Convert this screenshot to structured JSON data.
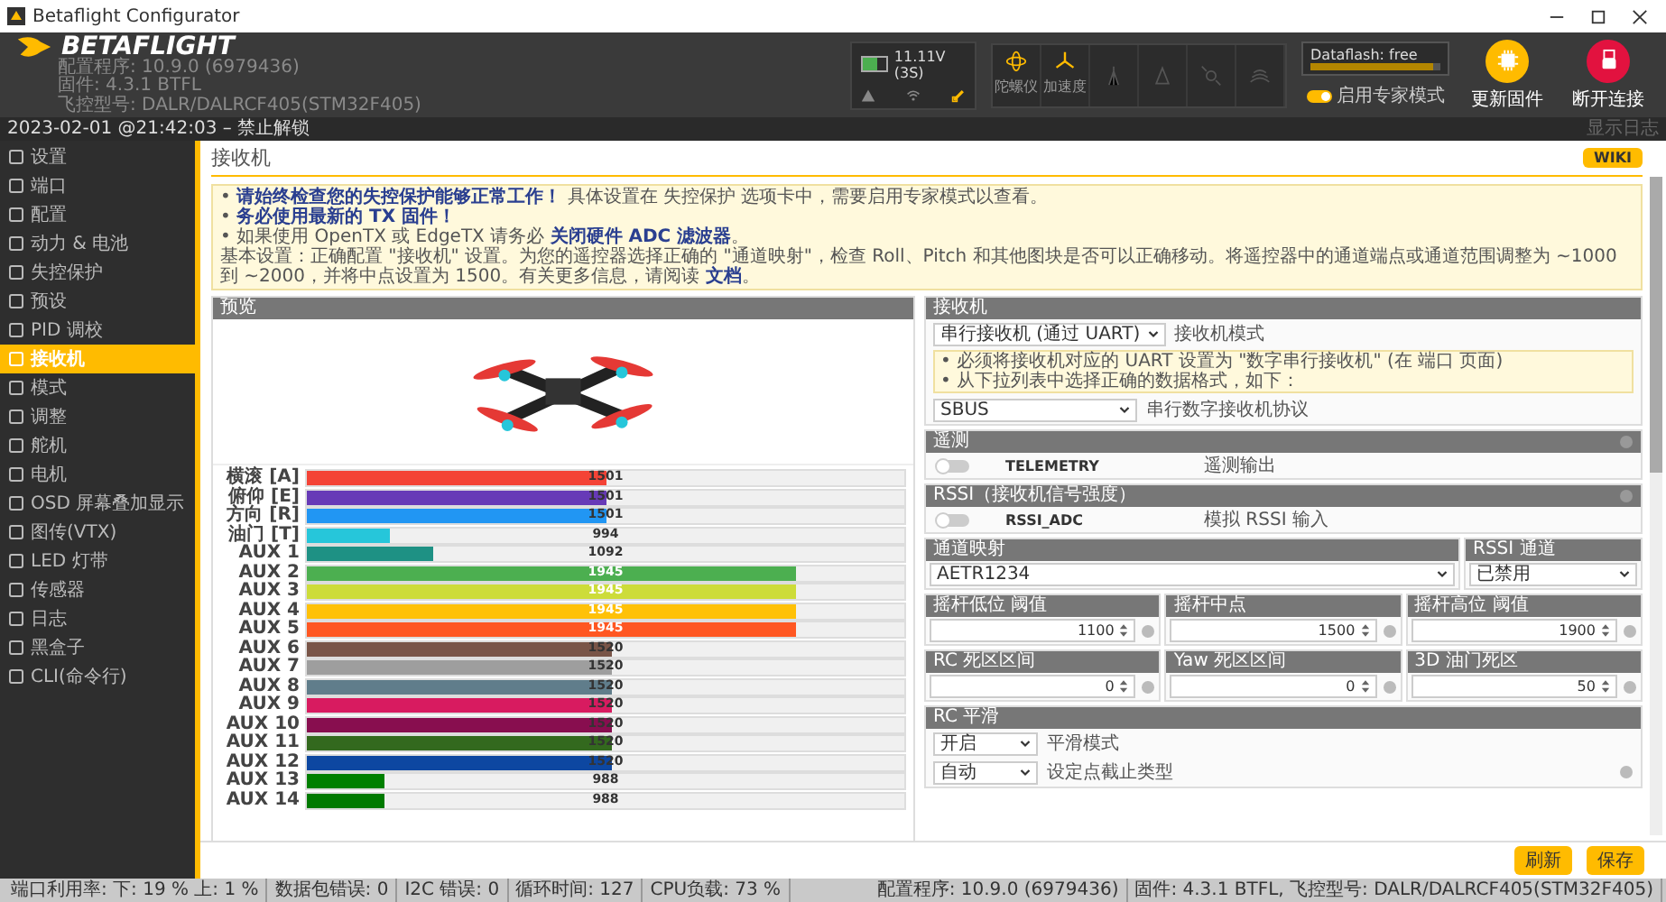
{
  "window": {
    "title": "Betaflight Configurator"
  },
  "header": {
    "logo": "BETAFLIGHT",
    "versions": [
      "配置程序: 10.9.0 (6979436)",
      "固件: 4.3.1 BTFL",
      "飞控型号: DALR/DALRCF405(STM32F405)"
    ],
    "battery": {
      "reading": "11.11V (3S)",
      "level": 0.6
    },
    "sensors": [
      {
        "kind": "gyro",
        "label": "陀螺仪",
        "on": true
      },
      {
        "kind": "acc",
        "label": "加速度",
        "on": true
      },
      {
        "kind": "baro",
        "on": false
      },
      {
        "kind": "mag",
        "on": false
      },
      {
        "kind": "gps",
        "on": false
      },
      {
        "kind": "sonar",
        "on": false
      }
    ],
    "dataflash": {
      "label": "Dataflash: free",
      "level": 0.95
    },
    "expert_mode": {
      "label": "启用专家模式",
      "on": true
    },
    "buttons": [
      {
        "kind": "update",
        "label": "更新固件"
      },
      {
        "kind": "disconnect",
        "label": "断开连接"
      }
    ]
  },
  "info_bar": {
    "datetime": "2023-02-01 @21:42:03 – 禁止解锁",
    "log_link": "显示日志"
  },
  "sidebar": {
    "items": [
      {
        "label": "设置",
        "selected": false
      },
      {
        "label": "端口",
        "selected": false
      },
      {
        "label": "配置",
        "selected": false
      },
      {
        "label": "动力 & 电池",
        "selected": false
      },
      {
        "label": "失控保护",
        "selected": false
      },
      {
        "label": "预设",
        "selected": false
      },
      {
        "label": "PID 调校",
        "selected": false
      },
      {
        "label": "接收机",
        "selected": true
      },
      {
        "label": "模式",
        "selected": false
      },
      {
        "label": "调整",
        "selected": false
      },
      {
        "label": "舵机",
        "selected": false
      },
      {
        "label": "电机",
        "selected": false
      },
      {
        "label": "OSD 屏幕叠加显示",
        "selected": false
      },
      {
        "label": "图传(VTX)",
        "selected": false
      },
      {
        "label": "LED 灯带",
        "selected": false
      },
      {
        "label": "传感器",
        "selected": false
      },
      {
        "label": "日志",
        "selected": false
      },
      {
        "label": "黑盒子",
        "selected": false
      },
      {
        "label": "CLI(命令行)",
        "selected": false
      }
    ]
  },
  "page": {
    "title": "接收机",
    "wiki": "WIKI",
    "notes": [
      "• **请始终检查您的失控保护能够正常工作！** 具体设置在 失控保护 选项卡中，需要启用专家模式以查看。",
      "• **务必使用最新的 TX 固件！**",
      "• 如果使用 OpenTX 或 EdgeTX 请务必 **关闭硬件 ADC 滤波器**。",
      "基本设置：正确配置 \"接收机\" 设置。为您的遥控器选择正确的 \"通道映射\"，检查 Roll、Pitch 和其他图块是否可以正确移动。将遥控器中的通道端点或通道范围调整为 ~1000 到 ~2000，并将中点设置为 1500。有关更多信息，请阅读 **文档**。"
    ],
    "preview": {
      "title": "预览"
    },
    "channels": [
      {
        "name": "横滚 [A]",
        "level": 0.5,
        "reading": "1501",
        "color": "#f44336"
      },
      {
        "name": "俯仰 [E]",
        "level": 0.5,
        "reading": "1501",
        "color": "#673ab7"
      },
      {
        "name": "方向 [R]",
        "level": 0.5,
        "reading": "1501",
        "color": "#2196f3"
      },
      {
        "name": "油门 [T]",
        "level": 0.14,
        "reading": "994",
        "color": "#26c6da"
      },
      {
        "name": "AUX 1",
        "level": 0.21,
        "reading": "1092",
        "color": "#1e9184"
      },
      {
        "name": "AUX 2",
        "level": 0.82,
        "reading": "1945",
        "color": "#4caf50"
      },
      {
        "name": "AUX 3",
        "level": 0.82,
        "reading": "1945",
        "color": "#cddc39"
      },
      {
        "name": "AUX 4",
        "level": 0.82,
        "reading": "1945",
        "color": "#ffc107"
      },
      {
        "name": "AUX 5",
        "level": 0.82,
        "reading": "1945",
        "color": "#ff5722"
      },
      {
        "name": "AUX 6",
        "level": 0.51,
        "reading": "1520",
        "color": "#795548"
      },
      {
        "name": "AUX 7",
        "level": 0.51,
        "reading": "1520",
        "color": "#9e9e9e"
      },
      {
        "name": "AUX 8",
        "level": 0.51,
        "reading": "1520",
        "color": "#607d8b"
      },
      {
        "name": "AUX 9",
        "level": 0.51,
        "reading": "1520",
        "color": "#d81b60"
      },
      {
        "name": "AUX 10",
        "level": 0.51,
        "reading": "1520",
        "color": "#880e4f"
      },
      {
        "name": "AUX 11",
        "level": 0.51,
        "reading": "1520",
        "color": "#33691e"
      },
      {
        "name": "AUX 12",
        "level": 0.51,
        "reading": "1520",
        "color": "#0d47a1"
      },
      {
        "name": "AUX 13",
        "level": 0.13,
        "reading": "988",
        "color": "#008000"
      },
      {
        "name": "AUX 14",
        "level": 0.13,
        "reading": "988",
        "color": "#007a00"
      }
    ],
    "receiver": {
      "title": "接收机",
      "mode": {
        "value": "串行接收机 (通过 UART)",
        "label": "接收机模式"
      },
      "notes": [
        "• 必须将接收机对应的 UART 设置为 \"数字串行接收机\" (在 端口 页面)",
        "• 从下拉列表中选择正确的数据格式，如下："
      ],
      "protocol": {
        "value": "SBUS",
        "label": "串行数字接收机协议"
      }
    },
    "features": [
      {
        "title": "遥测",
        "name": "TELEMETRY",
        "description": "遥测输出",
        "on": false
      },
      {
        "title": "RSSI（接收机信号强度）",
        "name": "RSSI_ADC",
        "description": "模拟 RSSI 输入",
        "on": false
      }
    ],
    "channel_map": {
      "title": "通道映射",
      "value": "AETR1234"
    },
    "rssi_channel": {
      "title": "RSSI 通道",
      "value": "已禁用"
    },
    "number_groups": [
      {
        "fields": [
          {
            "title": "摇杆低位 阈值",
            "value": "1100"
          },
          {
            "title": "摇杆中点",
            "value": "1500"
          },
          {
            "title": "摇杆高位 阈值",
            "value": "1900"
          }
        ]
      },
      {
        "fields": [
          {
            "title": "RC 死区区间",
            "value": "0"
          },
          {
            "title": "Yaw 死区区间",
            "value": "0"
          },
          {
            "title": "3D 油门死区",
            "value": "50"
          }
        ]
      }
    ],
    "rc_smoothing": {
      "title": "RC 平滑",
      "rows": [
        {
          "value": "开启",
          "label": "平滑模式"
        },
        {
          "value": "自动",
          "label": "设定点截止类型"
        }
      ]
    }
  },
  "actions": [
    "刷新",
    "保存"
  ],
  "status_bar": {
    "left": [
      "端口利用率: 下: 19 % 上: 1 %",
      "数据包错误: 0",
      "I2C 错误: 0",
      "循环时间: 127",
      "CPU负载: 73 %"
    ],
    "right": [
      "配置程序: 10.9.0 (6979436)",
      "固件: 4.3.1 BTFL, 飞控型号: DALR/DALRCF405(STM32F405)"
    ]
  }
}
